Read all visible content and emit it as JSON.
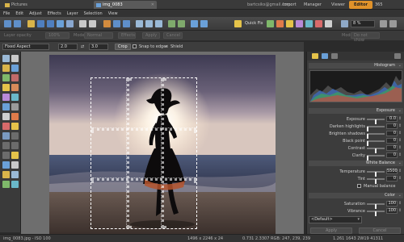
{
  "top_bar": {
    "tabs": [
      {
        "label": "Pictures",
        "icon": "folder-icon"
      },
      {
        "label": "img_0083",
        "icon": "image-icon"
      }
    ],
    "user": "bartcsiks@gmail.com",
    "modes": [
      "Import",
      "Manager",
      "Viewer",
      "Editor",
      "365"
    ],
    "active_mode": "Editor"
  },
  "menu": [
    "File",
    "Edit",
    "Adjust",
    "Effects",
    "Layer",
    "Selection",
    "View"
  ],
  "toolbar": {
    "quick_fix": "Quick Fix",
    "zoom": "8 %"
  },
  "toolbar2": {
    "layer_opacity": "Layer opacity",
    "opacity_value": "100%",
    "mode_label": "Mode",
    "mode_value": "Normal",
    "effects": "Effects",
    "apply": "Apply",
    "cancel": "Cancel",
    "right_mode": "Mode",
    "right_mode_value": "Do not show"
  },
  "crop_bar": {
    "aspect": "Fixed Aspect",
    "width": "2.0",
    "height": "3.0",
    "crop_button": "Crop",
    "snap": "Snap to edges",
    "shield": "Shield"
  },
  "right_panel": {
    "histogram_title": "Histogram",
    "exposure_title": "Exposure",
    "exposure_rows": [
      {
        "label": "Exposure",
        "value": "0.0",
        "pos": 0.5
      },
      {
        "label": "Darken highlights",
        "value": "0",
        "pos": 0.0
      },
      {
        "label": "Brighten shadows",
        "value": "0",
        "pos": 0.0
      },
      {
        "label": "Black point",
        "value": "0",
        "pos": 0.0
      },
      {
        "label": "Contrast",
        "value": "0",
        "pos": 0.5
      },
      {
        "label": "Clarity",
        "value": "0",
        "pos": 0.0
      }
    ],
    "white_balance_title": "White Balance",
    "wb_rows": [
      {
        "label": "Temperature",
        "value": "5500",
        "pos": 0.5
      },
      {
        "label": "Tint",
        "value": "0",
        "pos": 0.5
      }
    ],
    "manual_balance": "Manual balance",
    "color_title": "Color",
    "color_rows": [
      {
        "label": "Saturation",
        "value": "100",
        "pos": 0.5
      },
      {
        "label": "Vibrance",
        "value": "100",
        "pos": 0.5
      }
    ],
    "preset": "<Default>",
    "apply": "Apply",
    "cancel": "Cancel"
  },
  "status": {
    "file": "img_0083.jpg - ISO 100",
    "dimensions": "1496 x 2246 x 24",
    "info": "0.731 2.3307 RGB: 247, 239, 239",
    "coords": "1.261 1643 2W19 41311"
  },
  "colors": {
    "accent": "#e0922a",
    "panel": "#3c3c3c",
    "canvas": "#6e6e6e"
  }
}
